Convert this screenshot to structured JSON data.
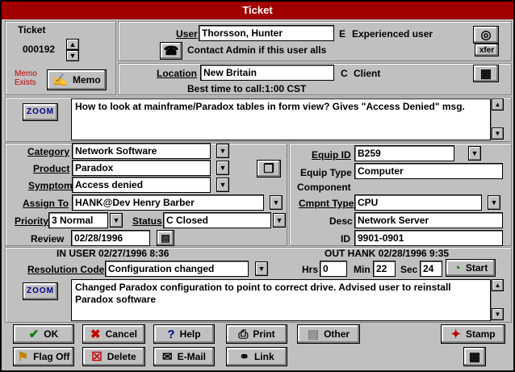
{
  "title": "Ticket",
  "ticket": {
    "label": "Ticket",
    "number": "000192",
    "memo_status": "Memo\nExists",
    "memo_button": "Memo"
  },
  "user": {
    "label": "User",
    "value": "Thorsson, Hunter",
    "code": "E",
    "desc": "Experienced user",
    "contact_msg": "Contact Admin if this user alls",
    "xfer": "xfer"
  },
  "location": {
    "label": "Location",
    "value": "New Britain",
    "code": "C",
    "desc": "Client",
    "best_time": "Best time to call:1:00 CST"
  },
  "zoom_label": "ZOOM",
  "problem_text": "How to look at mainframe/Paradox tables in form view?  Gives \"Access Denied\" msg.",
  "left_fields": {
    "category_label": "Category",
    "category": "Network Software",
    "product_label": "Product",
    "product": "Paradox",
    "symptom_label": "Symptom",
    "symptom": "Access denied",
    "assign_label": "Assign To",
    "assign": "HANK@Dev     Henry Barber",
    "priority_label": "Priority",
    "priority": "3     Normal",
    "status_label": "Status",
    "status": "C     Closed",
    "review_label": "Review",
    "review": "02/28/1996"
  },
  "right_fields": {
    "equip_id_label": "Equip ID",
    "equip_id": "B259",
    "equip_type_label": "Equip Type",
    "equip_type": "Computer",
    "component_label": "Component",
    "cmpnt_type_label": "Cmpnt Type",
    "cmpnt_type": "CPU",
    "desc_label": "Desc",
    "desc": "Network Server",
    "id_label": "ID",
    "id": "9901-0901"
  },
  "resolution": {
    "in_text": "IN  USER 02/27/1996  8:36",
    "out_text": "OUT HANK 02/28/1996  9:35",
    "code_label": "Resolution Code",
    "code": "Configuration changed",
    "hrs_label": "Hrs",
    "hrs": "0",
    "min_label": "Min",
    "min": "22",
    "sec_label": "Sec",
    "sec": "24",
    "start": "Start",
    "text": "Changed Paradox configuration to point to correct drive.  Advised user to reinstall Paradox software"
  },
  "buttons": {
    "ok": "OK",
    "cancel": "Cancel",
    "help": "Help",
    "print": "Print",
    "other": "Other",
    "stamp": "Stamp",
    "flag_off": "Flag Off",
    "delete": "Delete",
    "email": "E-Mail",
    "link": "Link"
  },
  "colors": {
    "title_bg": "#a00000",
    "memo_red": "#c00000",
    "zoom_blue": "#00008b"
  }
}
